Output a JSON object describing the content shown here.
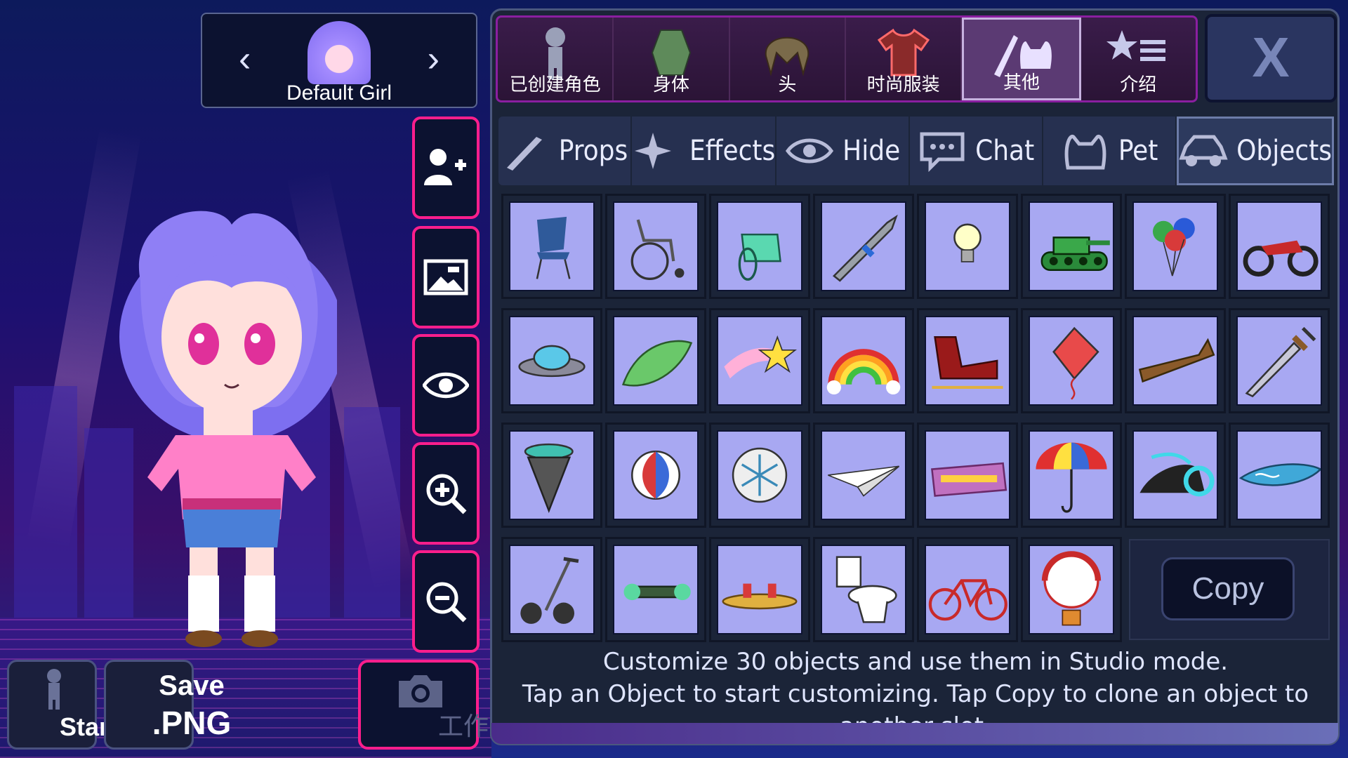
{
  "character": {
    "name": "Default Girl",
    "prev_icon": "chevron-left-icon",
    "next_icon": "chevron-right-icon"
  },
  "side_buttons": [
    {
      "name": "add-character-button",
      "icon": "user-plus-icon"
    },
    {
      "name": "background-button",
      "icon": "image-icon"
    },
    {
      "name": "hide-ui-button",
      "icon": "eye-icon"
    },
    {
      "name": "zoom-in-button",
      "icon": "zoom-in-icon"
    },
    {
      "name": "zoom-out-button",
      "icon": "zoom-out-icon"
    }
  ],
  "bottom_left": {
    "stand_label": "Stand",
    "save_label_1": "Save",
    "save_label_2": ".PNG",
    "studio_label": "工作室"
  },
  "top_tabs": [
    {
      "label": "已创建角色",
      "icon": "character-icon"
    },
    {
      "label": "身体",
      "icon": "body-icon"
    },
    {
      "label": "头",
      "icon": "hair-icon"
    },
    {
      "label": "时尚服装",
      "icon": "shirt-icon"
    },
    {
      "label": "其他",
      "icon": "sword-cat-icon",
      "active": true
    },
    {
      "label": "介绍",
      "icon": "star-list-icon"
    }
  ],
  "close_label": "X",
  "sub_tabs": [
    {
      "label": "Props",
      "icon": "sword-icon"
    },
    {
      "label": "Effects",
      "icon": "sparkle-icon"
    },
    {
      "label": "Hide",
      "icon": "eye-icon"
    },
    {
      "label": "Chat",
      "icon": "chat-bubble-icon"
    },
    {
      "label": "Pet",
      "icon": "cat-icon"
    },
    {
      "label": "Objects",
      "icon": "car-icon",
      "active": true
    }
  ],
  "objects": [
    "chair-icon",
    "wheelchair-icon",
    "hover-wheelchair-icon",
    "missile-icon",
    "lightbulb-icon",
    "tank-icon",
    "balloons-icon",
    "motorcycle-icon",
    "ufo-icon",
    "leaf-icon",
    "shooting-star-icon",
    "rainbow-icon",
    "sleigh-icon",
    "kite-icon",
    "hoverboard-seat-icon",
    "sword-icon",
    "drill-icon",
    "beach-ball-icon",
    "snowflake-orb-icon",
    "paper-airplane-icon",
    "magic-carpet-icon",
    "umbrella-icon",
    "hover-bike-icon",
    "surfboard-icon",
    "segway-icon",
    "hoverboard-icon",
    "skateboard-icon",
    "toilet-icon",
    "bicycle-icon",
    "hot-air-balloon-icon"
  ],
  "copy_label": "Copy",
  "info_line_1": "Customize 30 objects and use them in Studio mode.",
  "info_line_2": "Tap an Object to start customizing. Tap Copy to clone an object to another slot.",
  "colors": {
    "accent_pink": "#ff1e8c",
    "cell_bg": "#a8a8f2",
    "panel_bg": "#1b2438"
  }
}
